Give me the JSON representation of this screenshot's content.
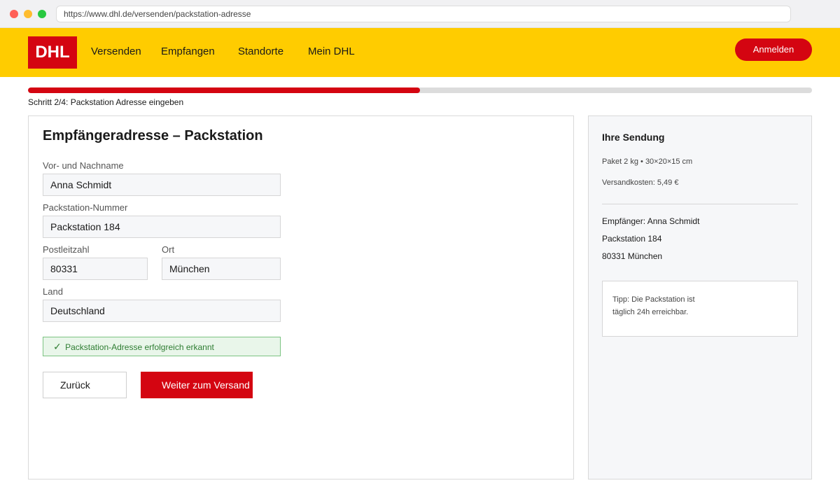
{
  "browser": {
    "url": "https://www.dhl.de/versenden/packstation-adresse"
  },
  "header": {
    "logo_text": "DHL",
    "nav": [
      {
        "label": "Versenden"
      },
      {
        "label": "Empfangen"
      },
      {
        "label": "Standorte"
      },
      {
        "label": "Mein DHL"
      }
    ],
    "login_label": "Anmelden"
  },
  "progress": {
    "step_text": "Schritt 2/4: Packstation Adresse eingeben",
    "fraction": 0.5
  },
  "form": {
    "title": "Empfängeradresse – Packstation",
    "fields": {
      "name": {
        "label": "Vor- und Nachname",
        "value": "Anna Schmidt"
      },
      "packstation": {
        "label": "Packstation-Nummer",
        "value": "Packstation 184"
      },
      "zip": {
        "label": "Postleitzahl",
        "value": "80331"
      },
      "city": {
        "label": "Ort",
        "value": "München"
      },
      "country": {
        "label": "Land",
        "value": "Deutschland"
      }
    },
    "success_message": "Packstation-Adresse erfolgreich erkannt",
    "back_label": "Zurück",
    "next_label": "Weiter zum Versand"
  },
  "summary": {
    "title": "Ihre Sendung",
    "package": "Paket 2 kg • 30×20×15 cm",
    "cost": "Versandkosten: 5,49 €",
    "recipient_name": "Empfänger: Anna Schmidt",
    "recipient_station": "Packstation 184",
    "recipient_city": "80331 München",
    "tip_line1": "Tipp: Die Packstation ist",
    "tip_line2": "täglich 24h erreichbar."
  },
  "colors": {
    "brand_yellow": "#ffcc00",
    "brand_red": "#d40511",
    "success_green": "#2e7d32"
  }
}
